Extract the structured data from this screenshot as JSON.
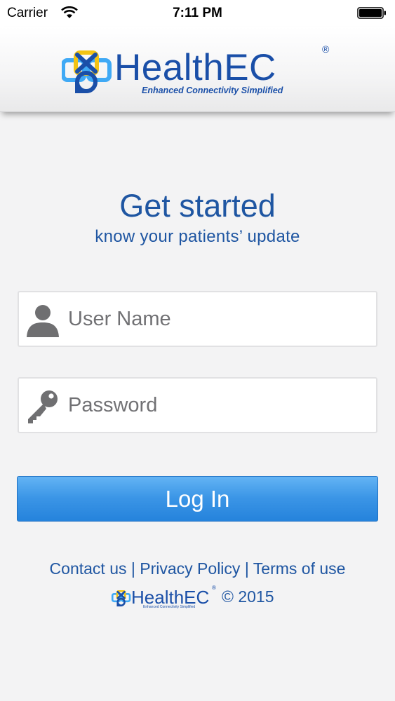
{
  "status_bar": {
    "carrier": "Carrier",
    "time": "7:11 PM"
  },
  "header": {
    "brand_name": "HealthEC",
    "registered_mark": "®",
    "tagline": "Enhanced Connectivity Simplified"
  },
  "main": {
    "title": "Get started",
    "subtitle": "know your patients’ update"
  },
  "form": {
    "username_placeholder": "User Name",
    "password_placeholder": "Password",
    "login_label": "Log In"
  },
  "footer": {
    "contact_label": "Contact us",
    "privacy_label": "Privacy Policy",
    "terms_label": "Terms of use",
    "separator": "|",
    "brand_name": "HealthEC",
    "registered_mark": "®",
    "tagline": "Enhanced Connectivity Simplified",
    "copyright": "© 2015"
  },
  "icons": {
    "wifi": "wifi-icon",
    "battery": "battery-icon",
    "logo": "healthec-logo-icon",
    "user": "user-icon",
    "key": "key-icon"
  },
  "colors": {
    "brand_blue": "#1a4fa8",
    "text_blue": "#1f56a2",
    "logo_yellow": "#f2c315",
    "logo_light_blue": "#3fa9f5",
    "button_top": "#63b4f4",
    "button_bottom": "#2583dc",
    "background": "#f3f3f4"
  }
}
